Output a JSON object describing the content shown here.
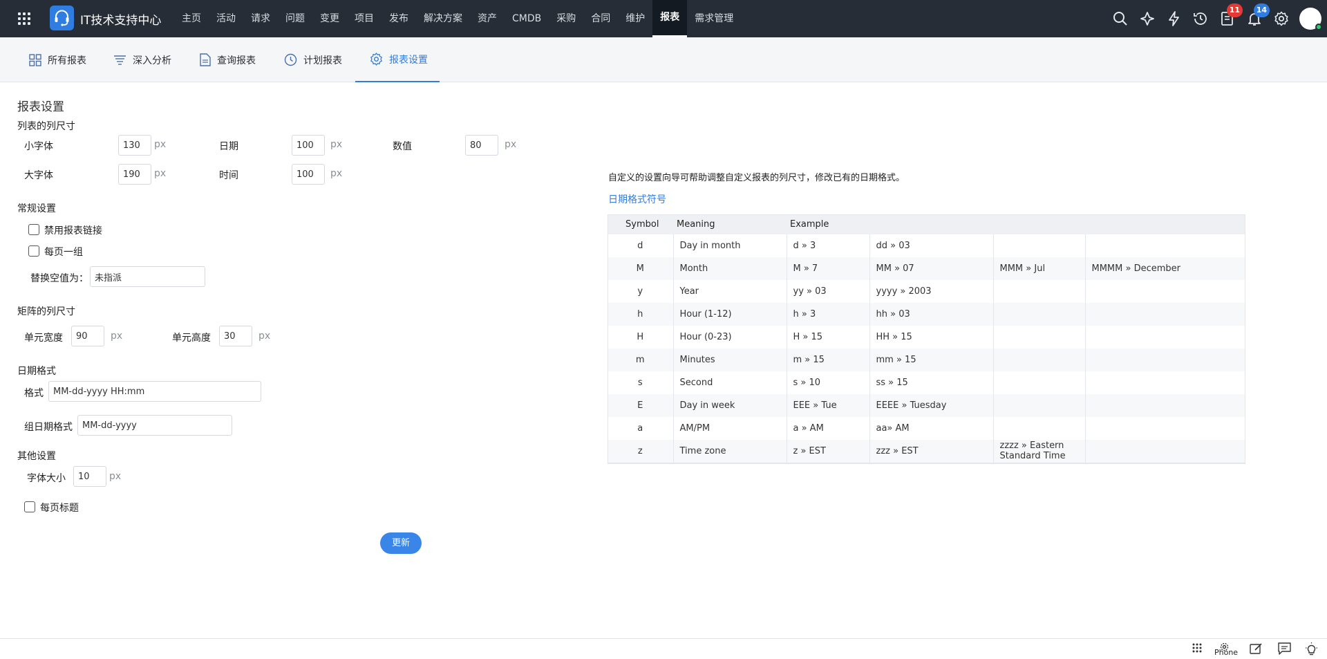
{
  "app": {
    "title": "IT技术支持中心"
  },
  "nav": [
    "主页",
    "活动",
    "请求",
    "问题",
    "变更",
    "项目",
    "发布",
    "解决方案",
    "资产",
    "CMDB",
    "采购",
    "合同",
    "维护",
    "报表",
    "需求管理"
  ],
  "nav_active": "报表",
  "badges": {
    "tasks": "11",
    "notifications": "14"
  },
  "subtabs": [
    {
      "label": "所有报表",
      "icon": "grid-icon"
    },
    {
      "label": "深入分析",
      "icon": "filter-icon"
    },
    {
      "label": "查询报表",
      "icon": "document-icon"
    },
    {
      "label": "计划报表",
      "icon": "clock-icon"
    },
    {
      "label": "报表设置",
      "icon": "gear-icon"
    }
  ],
  "form": {
    "page_title": "报表设置",
    "list_size": {
      "heading": "列表的列尺寸",
      "small_font_label": "小字体",
      "small_font": "130",
      "large_font_label": "大字体",
      "large_font": "190",
      "date_label": "日期",
      "date": "100",
      "time_label": "时间",
      "time": "100",
      "number_label": "数值",
      "number": "80",
      "unit": "px"
    },
    "general": {
      "heading": "常规设置",
      "disable_links": "禁用报表链接",
      "one_group_per_page": "每页一组",
      "replace_empty_label": "替换空值为：",
      "replace_empty_value": "未指派"
    },
    "matrix": {
      "heading": "矩阵的列尺寸",
      "cell_width_label": "单元宽度",
      "cell_width": "90",
      "cell_height_label": "单元高度",
      "cell_height": "30",
      "unit": "px"
    },
    "date_format": {
      "heading": "日期格式",
      "format_label": "格式",
      "format_value": "MM-dd-yyyy HH:mm",
      "group_label": "组日期格式",
      "group_value": "MM-dd-yyyy"
    },
    "other": {
      "heading": "其他设置",
      "font_size_label": "字体大小",
      "font_size": "10",
      "unit": "px",
      "title_per_page": "每页标题"
    },
    "update_button": "更新"
  },
  "help": {
    "description": "自定义的设置向导可帮助调整自定义报表的列尺寸，修改已有的日期格式。",
    "link": "日期格式符号",
    "headers": [
      "Symbol",
      "Meaning",
      "Example"
    ],
    "rows": [
      [
        "d",
        "Day in month",
        "d » 3",
        "dd » 03",
        "",
        ""
      ],
      [
        "M",
        "Month",
        "M » 7",
        "MM » 07",
        "MMM » Jul",
        "MMMM » December"
      ],
      [
        "y",
        "Year",
        "yy » 03",
        "yyyy » 2003",
        "",
        ""
      ],
      [
        "h",
        "Hour (1-12)",
        "h » 3",
        "hh » 03",
        "",
        ""
      ],
      [
        "H",
        "Hour (0-23)",
        "H » 15",
        "HH » 15",
        "",
        ""
      ],
      [
        "m",
        "Minutes",
        "m » 15",
        "mm » 15",
        "",
        ""
      ],
      [
        "s",
        "Second",
        "s » 10",
        "ss » 15",
        "",
        ""
      ],
      [
        "E",
        "Day in week",
        "EEE » Tue",
        "EEEE » Tuesday",
        "",
        ""
      ],
      [
        "a",
        "AM/PM",
        "a » AM",
        "aa» AM",
        "",
        ""
      ],
      [
        "z",
        "Time zone",
        "z » EST",
        "zzz » EST",
        "zzzz » Eastern Standard Time",
        ""
      ]
    ]
  },
  "bottombar": {
    "phone": "Phone"
  },
  "colors": {
    "topbar": "#262d36",
    "accent": "#2f7de1",
    "badge_red": "#e53935"
  }
}
